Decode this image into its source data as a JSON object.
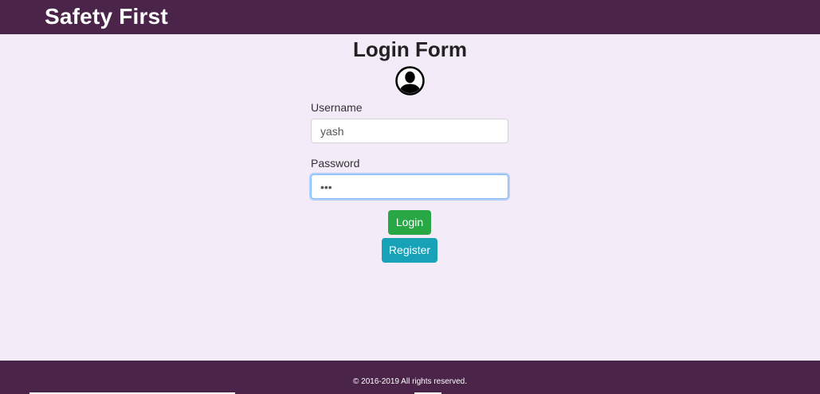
{
  "app": {
    "brand": "Safety First"
  },
  "form": {
    "title": "Login Form",
    "avatar_icon": "user-circle-icon",
    "username_label": "Username",
    "username_value": "yash",
    "password_label": "Password",
    "password_value": "•••",
    "login_label": "Login",
    "register_label": "Register"
  },
  "footer": {
    "text": "© 2016-2019 All rights reserved."
  },
  "colors": {
    "header_bg": "#4a2449",
    "page_bg": "#f3ebf8",
    "login_button": "#28a745",
    "register_button": "#17a2b8",
    "focus_ring": "#80bdff"
  }
}
